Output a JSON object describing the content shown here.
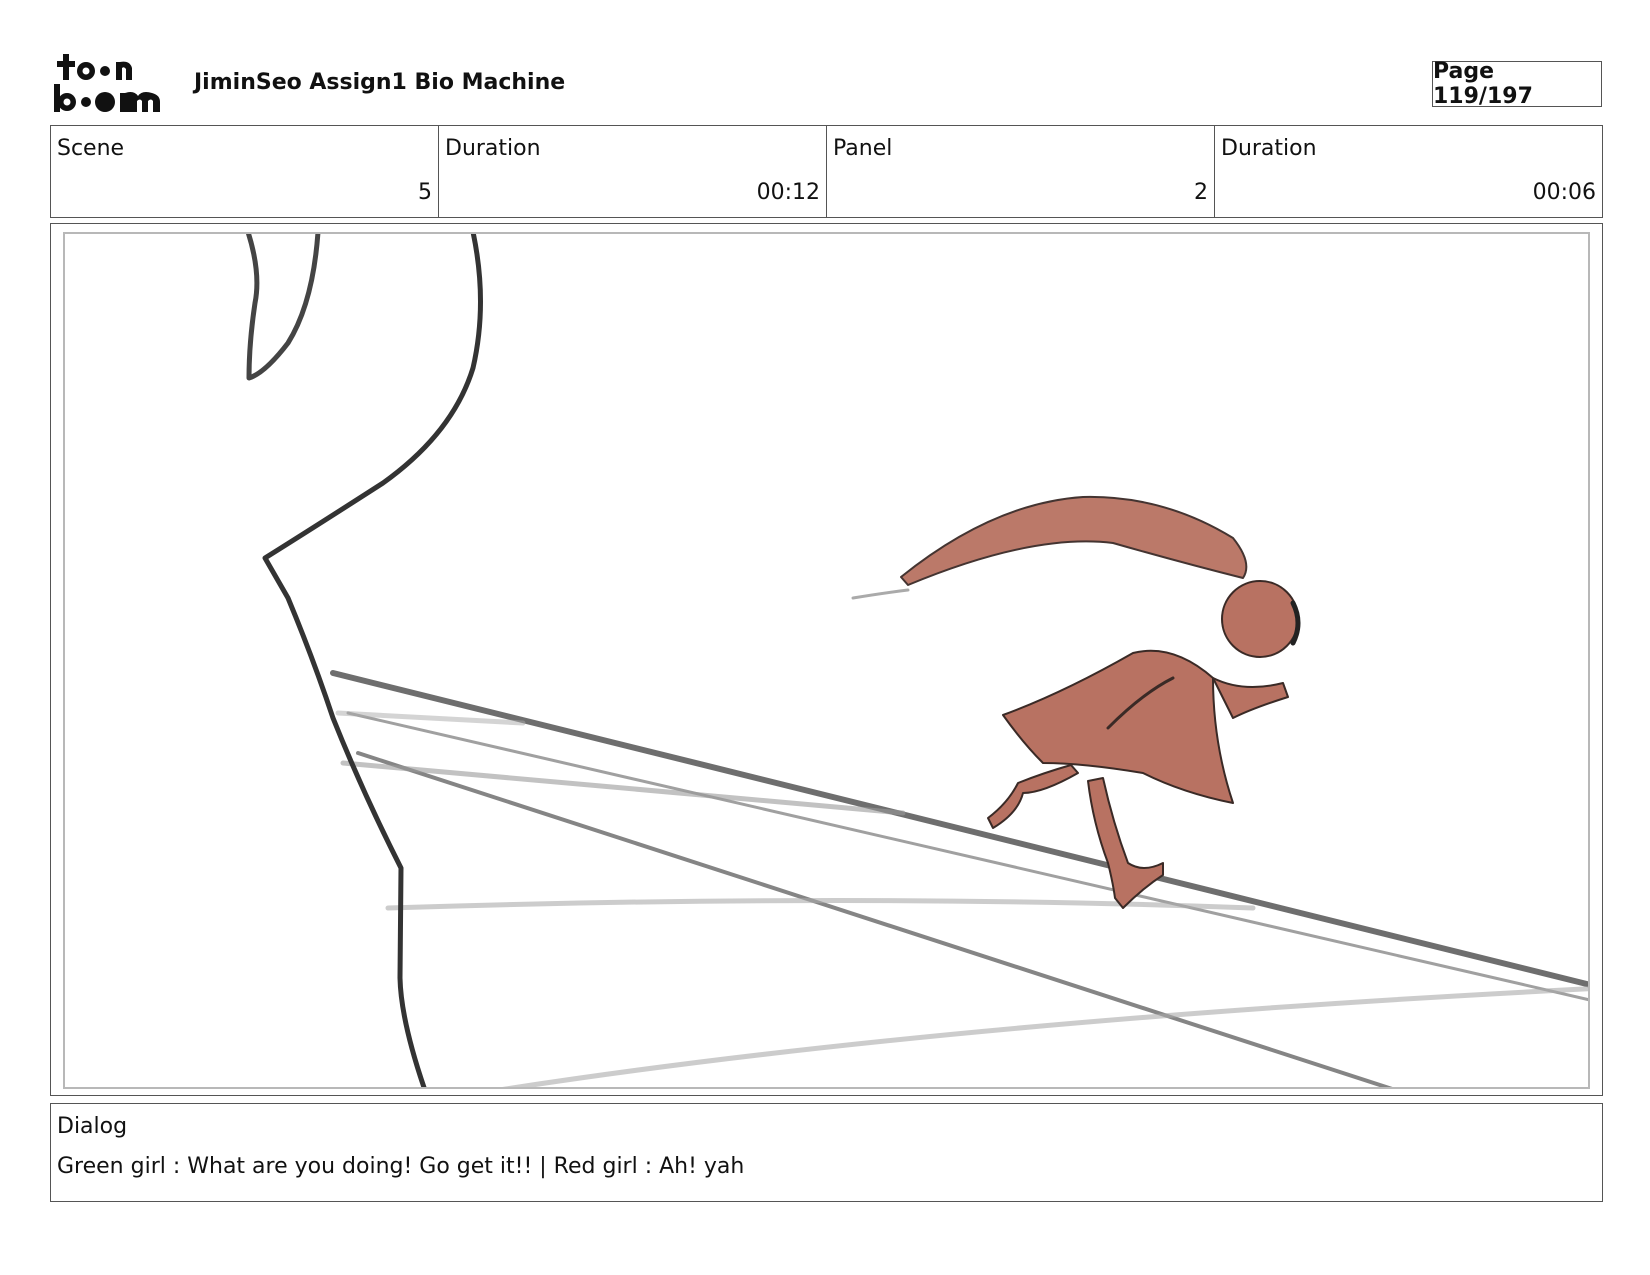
{
  "header": {
    "logo": "toon boom",
    "project_title": "JiminSeo Assign1 Bio Machine",
    "page_label": "Page 119/197"
  },
  "info": {
    "scene_label": "Scene",
    "scene_value": "5",
    "scene_duration_label": "Duration",
    "scene_duration_value": "00:12",
    "panel_label": "Panel",
    "panel_value": "2",
    "panel_duration_label": "Duration",
    "panel_duration_value": "00:06"
  },
  "dialog": {
    "label": "Dialog",
    "text": "Green girl : What are you doing! Go get it!! | Red girl : Ah! yah"
  },
  "colors": {
    "character": "#b87262",
    "character_outline": "#3a2a26",
    "sketch_line": "#333333",
    "frame_border": "#b8b8b8"
  }
}
